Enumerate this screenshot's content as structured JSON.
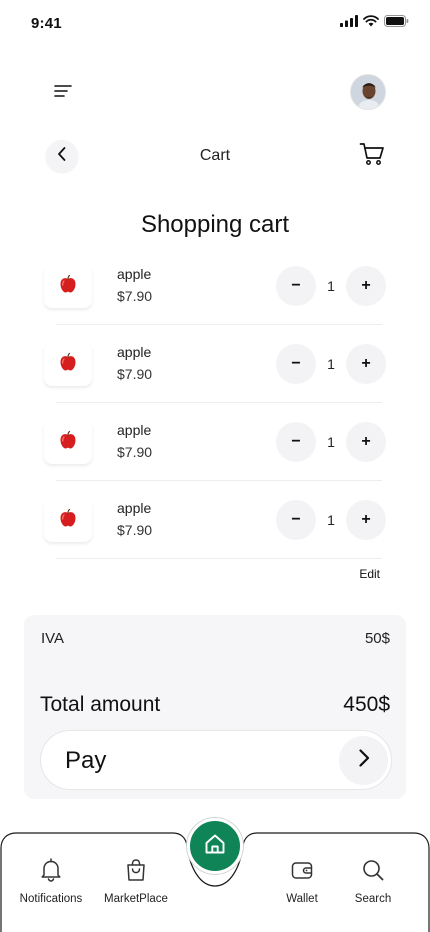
{
  "status_bar": {
    "time": "9:41"
  },
  "header": {
    "title": "Cart"
  },
  "page": {
    "title": "Shopping cart"
  },
  "cart": {
    "items": [
      {
        "name": "apple",
        "price": "$7.90",
        "quantity": "1"
      },
      {
        "name": "apple",
        "price": "$7.90",
        "quantity": "1"
      },
      {
        "name": "apple",
        "price": "$7.90",
        "quantity": "1"
      },
      {
        "name": "apple",
        "price": "$7.90",
        "quantity": "1"
      }
    ],
    "minus_symbol": "−",
    "plus_symbol": "+",
    "edit_label": "Edit"
  },
  "summary": {
    "iva_label": "IVA",
    "iva_value": "50$",
    "total_label": "Total amount",
    "total_value": "450$",
    "pay_label": "Pay"
  },
  "bottom_nav": {
    "items": [
      {
        "label": "Notifications",
        "icon": "bell-icon"
      },
      {
        "label": "MarketPlace",
        "icon": "shopping-bag-icon"
      },
      {
        "label": "Wallet",
        "icon": "wallet-icon"
      },
      {
        "label": "Search",
        "icon": "search-icon"
      }
    ],
    "home_icon": "home-icon"
  },
  "colors": {
    "accent": "#0f8457",
    "card_background": "#f6f6f9",
    "button_background": "#f3f3f6"
  }
}
